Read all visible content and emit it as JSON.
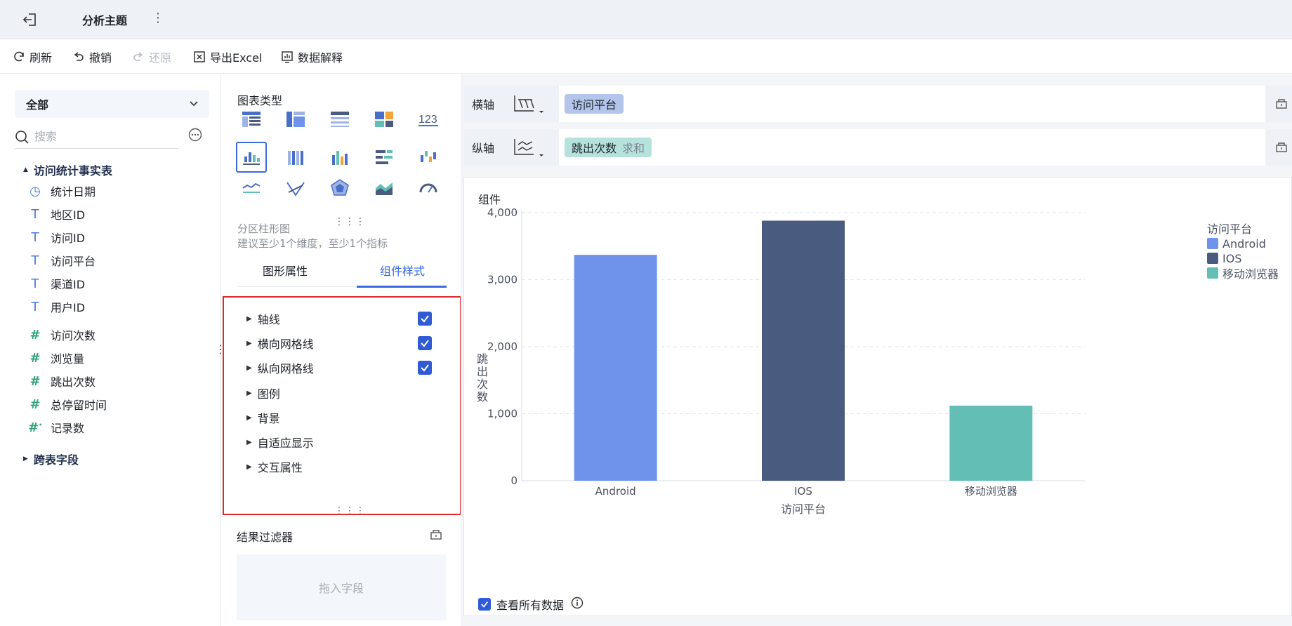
{
  "topbar": {
    "title": "分析主题"
  },
  "toolbar": {
    "refresh": "刷新",
    "undo": "撤销",
    "redo": "还原",
    "export": "导出Excel",
    "explain": "数据解释"
  },
  "left": {
    "scope": "全部",
    "search_placeholder": "搜索",
    "table_name": "访问统计事实表",
    "dim_fields": [
      "统计日期",
      "地区ID",
      "访问ID",
      "访问平台",
      "渠道ID",
      "用户ID"
    ],
    "measure_fields": [
      "访问次数",
      "浏览量",
      "跳出次数",
      "总停留时间",
      "记录数"
    ],
    "cross_table": "跨表字段"
  },
  "mid": {
    "chart_type_title": "图表类型",
    "chart_name": "分区柱形图",
    "chart_hint": "建议至少1个维度，至少1个指标",
    "tab_graph": "图形属性",
    "tab_style": "组件样式",
    "style_items": [
      {
        "label": "轴线",
        "checked": true
      },
      {
        "label": "横向网格线",
        "checked": true
      },
      {
        "label": "纵向网格线",
        "checked": true
      },
      {
        "label": "图例",
        "checked": false
      },
      {
        "label": "背景",
        "checked": false
      },
      {
        "label": "自适应显示",
        "checked": false
      },
      {
        "label": "交互属性",
        "checked": false
      }
    ],
    "filter_title": "结果过滤器",
    "drop_hint": "拖入字段"
  },
  "right": {
    "x_axis_label": "横轴",
    "y_axis_label": "纵轴",
    "x_field": "访问平台",
    "y_field": "跳出次数",
    "y_agg": "求和",
    "card_title": "组件",
    "view_all": "查看所有数据"
  },
  "chart_data": {
    "type": "bar",
    "categories": [
      "Android",
      "IOS",
      "移动浏览器"
    ],
    "values": [
      3370,
      3880,
      1120
    ],
    "colors": [
      "#6f93eb",
      "#4a5b80",
      "#63bfb5"
    ],
    "xlabel": "访问平台",
    "ylabel": "跳出次数",
    "ylim": [
      0,
      4000
    ],
    "yticks": [
      0,
      1000,
      2000,
      3000,
      4000
    ],
    "ytick_labels": [
      "0",
      "1,000",
      "2,000",
      "3,000",
      "4,000"
    ],
    "legend_title": "访问平台",
    "legend": [
      "Android",
      "IOS",
      "移动浏览器"
    ],
    "legend_position": "right",
    "grid": true
  }
}
